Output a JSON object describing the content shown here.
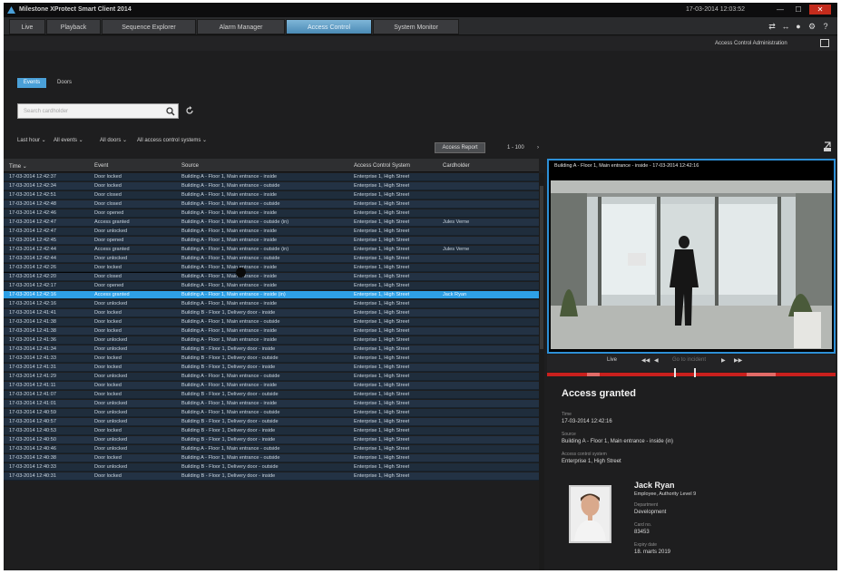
{
  "window": {
    "title": "Milestone XProtect Smart Client 2014",
    "clock": "17-03-2014 12:03:52",
    "controls": [
      "—",
      "☐",
      "✕"
    ]
  },
  "tabs": [
    {
      "label": "Live",
      "active": false
    },
    {
      "label": "Playback",
      "active": false
    },
    {
      "label": "Sequence Explorer",
      "active": false
    },
    {
      "label": "Alarm Manager",
      "active": false
    },
    {
      "label": "Access Control",
      "active": true
    },
    {
      "label": "System Monitor",
      "active": false
    }
  ],
  "toolbar_icons": [
    "camera-arrows-icon",
    "arrows-icon",
    "info-icon",
    "gear-icon",
    "help-icon"
  ],
  "subheader": {
    "admin_label": "Access Control Administration"
  },
  "view_toggle": {
    "events": "Events",
    "doors": "Doors"
  },
  "search": {
    "placeholder": "Search cardholder"
  },
  "filters": [
    "Last hour ⌄",
    "All events ⌄",
    "All doors ⌄",
    "All access control systems ⌄"
  ],
  "actions": {
    "access_report": "Access Report",
    "pager": "1 - 100",
    "pager_chevron": "›"
  },
  "grid": {
    "columns": [
      "Time ⌄",
      "Event",
      "Source",
      "Access Control System",
      "Cardholder"
    ],
    "rows": [
      [
        "17-03-2014 12:42:37",
        "Door locked",
        "Building A - Floor 1, Main entrance - inside",
        "Enterprise 1, High Street",
        ""
      ],
      [
        "17-03-2014 12:42:34",
        "Door locked",
        "Building A - Floor 1, Main entrance - outside",
        "Enterprise 1, High Street",
        ""
      ],
      [
        "17-03-2014 12:42:51",
        "Door closed",
        "Building A - Floor 1, Main entrance - inside",
        "Enterprise 1, High Street",
        ""
      ],
      [
        "17-03-2014 12:42:48",
        "Door closed",
        "Building A - Floor 1, Main entrance - outside",
        "Enterprise 1, High Street",
        ""
      ],
      [
        "17-03-2014 12:42:46",
        "Door opened",
        "Building A - Floor 1, Main entrance - inside",
        "Enterprise 1, High Street",
        ""
      ],
      [
        "17-03-2014 12:42:47",
        "Access granted",
        "Building A - Floor 1, Main entrance - outside (in)",
        "Enterprise 1, High Street",
        "Jules Verne"
      ],
      [
        "17-03-2014 12:42:47",
        "Door unlocked",
        "Building A - Floor 1, Main entrance - inside",
        "Enterprise 1, High Street",
        ""
      ],
      [
        "17-03-2014 12:42:45",
        "Door opened",
        "Building A - Floor 1, Main entrance - inside",
        "Enterprise 1, High Street",
        ""
      ],
      [
        "17-03-2014 12:42:44",
        "Access granted",
        "Building A - Floor 1, Main entrance - outside (in)",
        "Enterprise 1, High Street",
        "Jules Verne"
      ],
      [
        "17-03-2014 12:42:44",
        "Door unlocked",
        "Building A - Floor 1, Main entrance - outside",
        "Enterprise 1, High Street",
        ""
      ],
      [
        "17-03-2014 12:42:26",
        "Door locked",
        "Building A - Floor 1, Main entrance - inside",
        "Enterprise 1, High Street",
        ""
      ],
      [
        "17-03-2014 12:42:20",
        "Door closed",
        "Building A - Floor 1, Main entrance - inside",
        "Enterprise 1, High Street",
        ""
      ],
      [
        "17-03-2014 12:42:17",
        "Door opened",
        "Building A - Floor 1, Main entrance - inside",
        "Enterprise 1, High Street",
        ""
      ],
      [
        "17-03-2014 12:42:16",
        "Access granted",
        "Building A - Floor 1, Main entrance - inside (in)",
        "Enterprise 1, High Street",
        "Jack Ryan"
      ],
      [
        "17-03-2014 12:42:16",
        "Door unlocked",
        "Building A - Floor 1, Main entrance - inside",
        "Enterprise 1, High Street",
        ""
      ],
      [
        "17-03-2014 12:41:41",
        "Door locked",
        "Building B - Floor 1, Delivery door - inside",
        "Enterprise 1, High Street",
        ""
      ],
      [
        "17-03-2014 12:41:38",
        "Door locked",
        "Building A - Floor 1, Main entrance - outside",
        "Enterprise 1, High Street",
        ""
      ],
      [
        "17-03-2014 12:41:38",
        "Door locked",
        "Building A - Floor 1, Main entrance - inside",
        "Enterprise 1, High Street",
        ""
      ],
      [
        "17-03-2014 12:41:36",
        "Door unlocked",
        "Building A - Floor 1, Main entrance - inside",
        "Enterprise 1, High Street",
        ""
      ],
      [
        "17-03-2014 12:41:34",
        "Door unlocked",
        "Building B - Floor 1, Delivery door - inside",
        "Enterprise 1, High Street",
        ""
      ],
      [
        "17-03-2014 12:41:33",
        "Door locked",
        "Building B - Floor 1, Delivery door - outside",
        "Enterprise 1, High Street",
        ""
      ],
      [
        "17-03-2014 12:41:31",
        "Door locked",
        "Building B - Floor 1, Delivery door - inside",
        "Enterprise 1, High Street",
        ""
      ],
      [
        "17-03-2014 12:41:29",
        "Door unlocked",
        "Building A - Floor 1, Main entrance - outside",
        "Enterprise 1, High Street",
        ""
      ],
      [
        "17-03-2014 12:41:11",
        "Door locked",
        "Building A - Floor 1, Main entrance - inside",
        "Enterprise 1, High Street",
        ""
      ],
      [
        "17-03-2014 12:41:07",
        "Door locked",
        "Building B - Floor 1, Delivery door - outside",
        "Enterprise 1, High Street",
        ""
      ],
      [
        "17-03-2014 12:41:01",
        "Door unlocked",
        "Building A - Floor 1, Main entrance - inside",
        "Enterprise 1, High Street",
        ""
      ],
      [
        "17-03-2014 12:40:59",
        "Door unlocked",
        "Building A - Floor 1, Main entrance - outside",
        "Enterprise 1, High Street",
        ""
      ],
      [
        "17-03-2014 12:40:57",
        "Door unlocked",
        "Building B - Floor 1, Delivery door - outside",
        "Enterprise 1, High Street",
        ""
      ],
      [
        "17-03-2014 12:40:53",
        "Door locked",
        "Building B - Floor 1, Delivery door - inside",
        "Enterprise 1, High Street",
        ""
      ],
      [
        "17-03-2014 12:40:50",
        "Door unlocked",
        "Building B - Floor 1, Delivery door - inside",
        "Enterprise 1, High Street",
        ""
      ],
      [
        "17-03-2014 12:40:46",
        "Door unlocked",
        "Building A - Floor 1, Main entrance - outside",
        "Enterprise 1, High Street",
        ""
      ],
      [
        "17-03-2014 12:40:38",
        "Door locked",
        "Building A - Floor 1, Main entrance - outside",
        "Enterprise 1, High Street",
        ""
      ],
      [
        "17-03-2014 12:40:33",
        "Door unlocked",
        "Building B - Floor 1, Delivery door - outside",
        "Enterprise 1, High Street",
        ""
      ],
      [
        "17-03-2014 12:40:31",
        "Door locked",
        "Building B - Floor 1, Delivery door - inside",
        "Enterprise 1, High Street",
        ""
      ]
    ],
    "selected_index": 13
  },
  "video": {
    "caption": "Building A - Floor 1, Main entrance - inside - 17-03-2014 12:42:16",
    "playback_left": "Live",
    "playback_right": "Go to incident"
  },
  "details": {
    "title": "Access granted",
    "time_label": "Time",
    "time_value": "17-03-2014 12:42:16",
    "source_label": "Source",
    "source_value": "Building A - Floor 1, Main entrance - inside (in)",
    "system_label": "Access control system",
    "system_value": "Enterprise 1, High Street",
    "person_name": "Jack Ryan",
    "person_role": "Employee, Authority Level 9",
    "department_label": "Department",
    "department_value": "Development",
    "cardno_label": "Card no.",
    "cardno_value": "83453",
    "expiry_label": "Expiry date",
    "expiry_value": "18. marts 2019"
  },
  "colors": {
    "accent": "#2ea0e6",
    "timeline": "#c9201d",
    "background": "#1e1e1f"
  }
}
